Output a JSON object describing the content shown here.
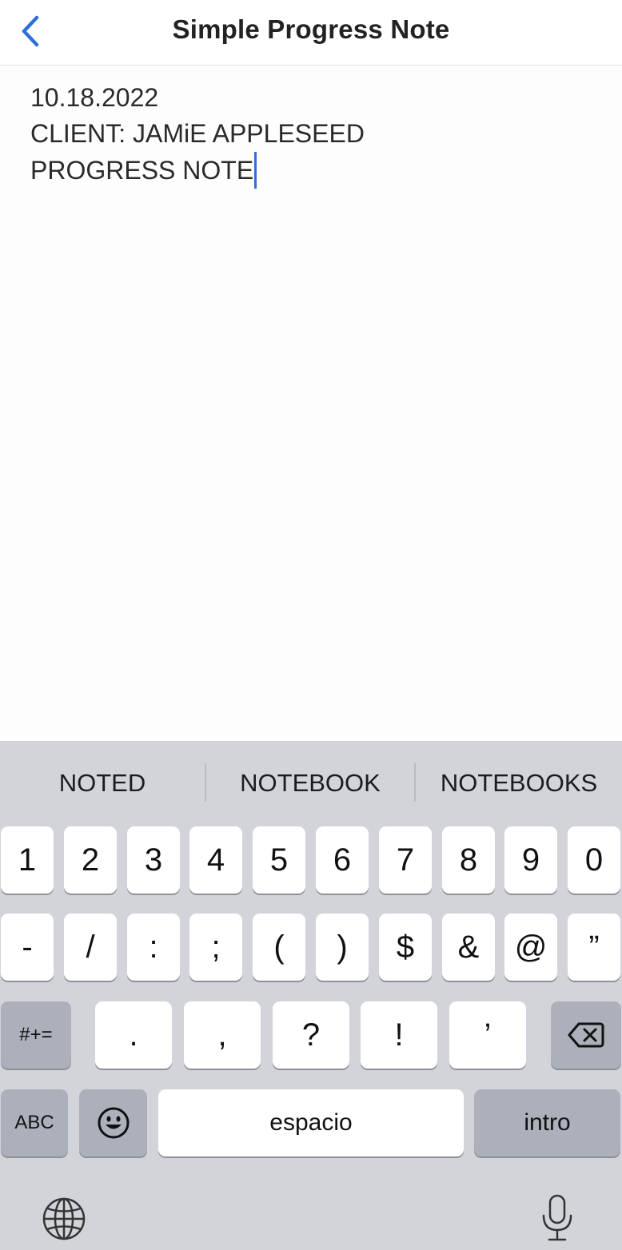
{
  "navbar": {
    "title": "Simple Progress Note",
    "back_icon": "chevron-left-icon",
    "accent_color": "#2f6fd6"
  },
  "note": {
    "lines": [
      "10.18.2022",
      "CLIENT: JAMiE APPLESEED",
      "PROGRESS NOTE"
    ]
  },
  "keyboard": {
    "suggestions": [
      "NOTED",
      "NOTEBOOK",
      "NOTEBOOKS"
    ],
    "row1": [
      "1",
      "2",
      "3",
      "4",
      "5",
      "6",
      "7",
      "8",
      "9",
      "0"
    ],
    "row2": [
      "-",
      "/",
      ":",
      ";",
      "(",
      ")",
      "$",
      "&",
      "@",
      "”"
    ],
    "row3": {
      "symbols_key": "#+=",
      "keys": [
        ".",
        ",",
        "?",
        "!",
        "’"
      ],
      "delete_icon": "backspace-icon"
    },
    "row4": {
      "abc_key": "ABC",
      "emoji_icon": "emoji-icon",
      "space_key": "espacio",
      "return_key": "intro"
    },
    "bottom": {
      "globe_icon": "globe-icon",
      "mic_icon": "microphone-icon"
    }
  }
}
